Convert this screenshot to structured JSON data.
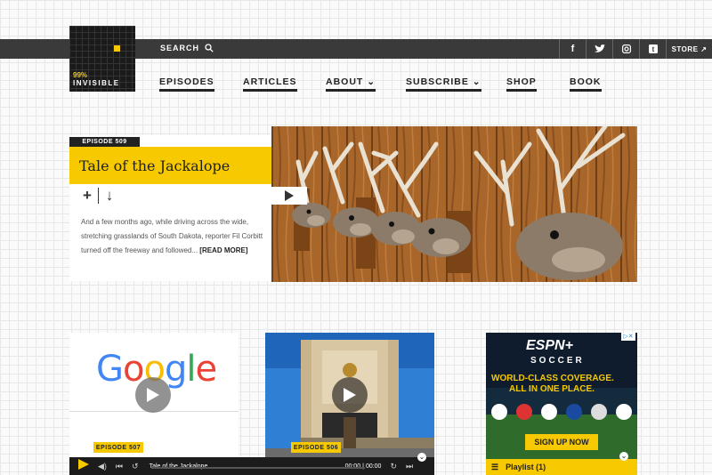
{
  "header": {
    "logo_top": "99%",
    "logo_bottom": "INVISIBLE",
    "search_label": "SEARCH",
    "store_label": "STORE",
    "social_icons": [
      "facebook-icon",
      "twitter-icon",
      "instagram-icon",
      "tumblr-icon"
    ]
  },
  "nav": {
    "items": [
      {
        "label": "EPISODES"
      },
      {
        "label": "ARTICLES"
      },
      {
        "label": "ABOUT"
      },
      {
        "label": "SUBSCRIBE"
      },
      {
        "label": "SHOP"
      },
      {
        "label": "BOOK"
      }
    ]
  },
  "featured": {
    "episode": "EPISODE 509",
    "title": "Tale of the Jackalope",
    "excerpt": "And a few months ago, while driving across the wide, stretching grasslands of South Dakota, reporter Fil Corbitt turned off the freeway and followed...",
    "read_more": "[READ MORE]"
  },
  "cards": [
    {
      "episode": "EPISODE 507",
      "logo_text": "Google"
    },
    {
      "episode": "EPISODE 506"
    }
  ],
  "ad": {
    "brand": "ESPN+",
    "sport": "SOCCER",
    "headline1": "WORLD-CLASS COVERAGE.",
    "headline2": "ALL IN ONE PLACE.",
    "cta": "SIGN UP NOW"
  },
  "player": {
    "track": "Tale of the Jackalope",
    "time_current": "00:00",
    "time_total": "00:00"
  },
  "playlist": {
    "label": "Playlist (1)"
  },
  "colors": {
    "accent": "#f6c900",
    "dark": "#222222",
    "bar": "#3a3a3a"
  }
}
